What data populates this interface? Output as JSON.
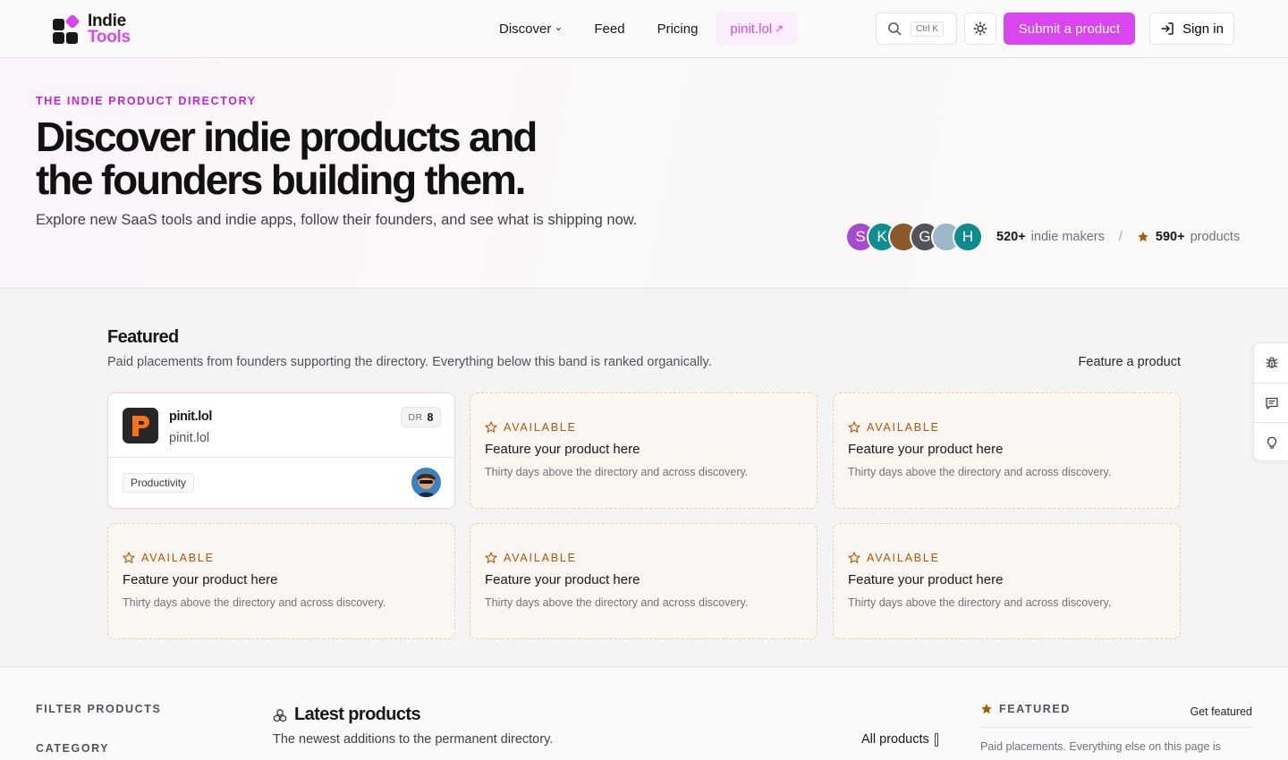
{
  "brand": {
    "line1": "Indie",
    "line2": "Tools",
    "accent": "#d946ef"
  },
  "nav": {
    "discover": "Discover",
    "feed": "Feed",
    "pricing": "Pricing",
    "pinit": "pinit.lol"
  },
  "search": {
    "shortcut": "Ctrl K"
  },
  "header": {
    "submit": "Submit a product",
    "signin": "Sign in"
  },
  "hero": {
    "eyebrow": "THE INDIE PRODUCT DIRECTORY",
    "title": "Discover indie products and the founders building them.",
    "subtitle": "Explore new SaaS tools and indie apps, follow their founders, and see what is shipping now.",
    "avatars": [
      {
        "letter": "S",
        "color": "#a64bd1"
      },
      {
        "letter": "K",
        "color": "#0e8f8f"
      },
      {
        "letter": "",
        "color": "#8b5a2b"
      },
      {
        "letter": "G",
        "color": "#52525b"
      },
      {
        "letter": "",
        "color": "#9cb8c9"
      },
      {
        "letter": "H",
        "color": "#0f8b8d"
      }
    ],
    "makers_count": "520+",
    "makers_label": "indie makers",
    "sep": "/",
    "products_count": "590+",
    "products_label": "products"
  },
  "featured": {
    "title": "Featured",
    "description": "Paid placements from founders supporting the directory. Everything below this band is ranked organically.",
    "link": "Feature a product",
    "product": {
      "name": "pinit.lol",
      "url": "pinit.lol",
      "dr_label": "DR",
      "dr_value": "8",
      "tag": "Productivity"
    },
    "slots": [
      {
        "label": "AVAILABLE",
        "title": "Feature your product here",
        "desc": "Thirty days above the directory and across discovery."
      },
      {
        "label": "AVAILABLE",
        "title": "Feature your product here",
        "desc": "Thirty days above the directory and across discovery."
      },
      {
        "label": "AVAILABLE",
        "title": "Feature your product here",
        "desc": "Thirty days above the directory and across discovery."
      },
      {
        "label": "AVAILABLE",
        "title": "Feature your product here",
        "desc": "Thirty days above the directory and across discovery."
      },
      {
        "label": "AVAILABLE",
        "title": "Feature your product here",
        "desc": "Thirty days above the directory and across discovery."
      }
    ]
  },
  "filters": {
    "heading": "FILTER PRODUCTS",
    "category": "CATEGORY"
  },
  "latest": {
    "title": "Latest products",
    "description": "The newest additions to the permanent directory.",
    "all": "All products"
  },
  "sidebar_featured": {
    "label": "FEATURED",
    "link": "Get featured",
    "description": "Paid placements. Everything else on this page is"
  },
  "icons": [
    "search-icon",
    "sun-icon",
    "sign-in-icon",
    "star-icon",
    "bug-icon",
    "message-icon",
    "lightbulb-icon",
    "boxes-icon",
    "chevron-down-icon",
    "arrow-up-right-icon"
  ]
}
